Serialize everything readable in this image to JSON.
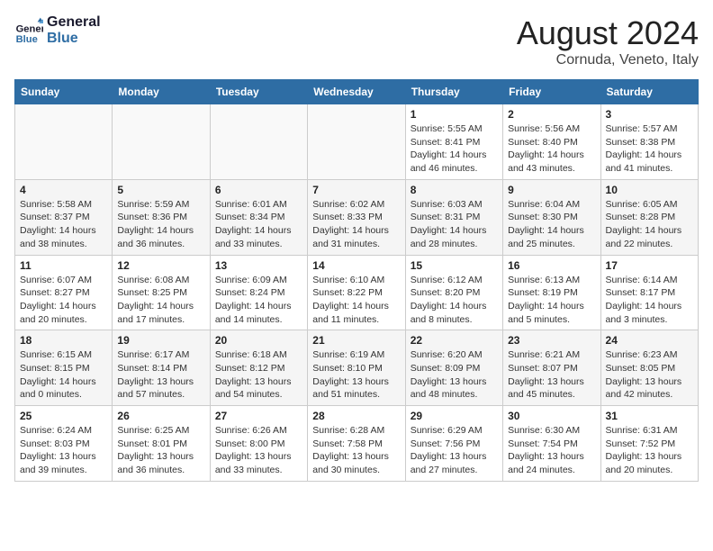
{
  "header": {
    "logo_line1": "General",
    "logo_line2": "Blue",
    "month_year": "August 2024",
    "location": "Cornuda, Veneto, Italy"
  },
  "weekdays": [
    "Sunday",
    "Monday",
    "Tuesday",
    "Wednesday",
    "Thursday",
    "Friday",
    "Saturday"
  ],
  "weeks": [
    [
      {
        "day": "",
        "info": ""
      },
      {
        "day": "",
        "info": ""
      },
      {
        "day": "",
        "info": ""
      },
      {
        "day": "",
        "info": ""
      },
      {
        "day": "1",
        "info": "Sunrise: 5:55 AM\nSunset: 8:41 PM\nDaylight: 14 hours\nand 46 minutes."
      },
      {
        "day": "2",
        "info": "Sunrise: 5:56 AM\nSunset: 8:40 PM\nDaylight: 14 hours\nand 43 minutes."
      },
      {
        "day": "3",
        "info": "Sunrise: 5:57 AM\nSunset: 8:38 PM\nDaylight: 14 hours\nand 41 minutes."
      }
    ],
    [
      {
        "day": "4",
        "info": "Sunrise: 5:58 AM\nSunset: 8:37 PM\nDaylight: 14 hours\nand 38 minutes."
      },
      {
        "day": "5",
        "info": "Sunrise: 5:59 AM\nSunset: 8:36 PM\nDaylight: 14 hours\nand 36 minutes."
      },
      {
        "day": "6",
        "info": "Sunrise: 6:01 AM\nSunset: 8:34 PM\nDaylight: 14 hours\nand 33 minutes."
      },
      {
        "day": "7",
        "info": "Sunrise: 6:02 AM\nSunset: 8:33 PM\nDaylight: 14 hours\nand 31 minutes."
      },
      {
        "day": "8",
        "info": "Sunrise: 6:03 AM\nSunset: 8:31 PM\nDaylight: 14 hours\nand 28 minutes."
      },
      {
        "day": "9",
        "info": "Sunrise: 6:04 AM\nSunset: 8:30 PM\nDaylight: 14 hours\nand 25 minutes."
      },
      {
        "day": "10",
        "info": "Sunrise: 6:05 AM\nSunset: 8:28 PM\nDaylight: 14 hours\nand 22 minutes."
      }
    ],
    [
      {
        "day": "11",
        "info": "Sunrise: 6:07 AM\nSunset: 8:27 PM\nDaylight: 14 hours\nand 20 minutes."
      },
      {
        "day": "12",
        "info": "Sunrise: 6:08 AM\nSunset: 8:25 PM\nDaylight: 14 hours\nand 17 minutes."
      },
      {
        "day": "13",
        "info": "Sunrise: 6:09 AM\nSunset: 8:24 PM\nDaylight: 14 hours\nand 14 minutes."
      },
      {
        "day": "14",
        "info": "Sunrise: 6:10 AM\nSunset: 8:22 PM\nDaylight: 14 hours\nand 11 minutes."
      },
      {
        "day": "15",
        "info": "Sunrise: 6:12 AM\nSunset: 8:20 PM\nDaylight: 14 hours\nand 8 minutes."
      },
      {
        "day": "16",
        "info": "Sunrise: 6:13 AM\nSunset: 8:19 PM\nDaylight: 14 hours\nand 5 minutes."
      },
      {
        "day": "17",
        "info": "Sunrise: 6:14 AM\nSunset: 8:17 PM\nDaylight: 14 hours\nand 3 minutes."
      }
    ],
    [
      {
        "day": "18",
        "info": "Sunrise: 6:15 AM\nSunset: 8:15 PM\nDaylight: 14 hours\nand 0 minutes."
      },
      {
        "day": "19",
        "info": "Sunrise: 6:17 AM\nSunset: 8:14 PM\nDaylight: 13 hours\nand 57 minutes."
      },
      {
        "day": "20",
        "info": "Sunrise: 6:18 AM\nSunset: 8:12 PM\nDaylight: 13 hours\nand 54 minutes."
      },
      {
        "day": "21",
        "info": "Sunrise: 6:19 AM\nSunset: 8:10 PM\nDaylight: 13 hours\nand 51 minutes."
      },
      {
        "day": "22",
        "info": "Sunrise: 6:20 AM\nSunset: 8:09 PM\nDaylight: 13 hours\nand 48 minutes."
      },
      {
        "day": "23",
        "info": "Sunrise: 6:21 AM\nSunset: 8:07 PM\nDaylight: 13 hours\nand 45 minutes."
      },
      {
        "day": "24",
        "info": "Sunrise: 6:23 AM\nSunset: 8:05 PM\nDaylight: 13 hours\nand 42 minutes."
      }
    ],
    [
      {
        "day": "25",
        "info": "Sunrise: 6:24 AM\nSunset: 8:03 PM\nDaylight: 13 hours\nand 39 minutes."
      },
      {
        "day": "26",
        "info": "Sunrise: 6:25 AM\nSunset: 8:01 PM\nDaylight: 13 hours\nand 36 minutes."
      },
      {
        "day": "27",
        "info": "Sunrise: 6:26 AM\nSunset: 8:00 PM\nDaylight: 13 hours\nand 33 minutes."
      },
      {
        "day": "28",
        "info": "Sunrise: 6:28 AM\nSunset: 7:58 PM\nDaylight: 13 hours\nand 30 minutes."
      },
      {
        "day": "29",
        "info": "Sunrise: 6:29 AM\nSunset: 7:56 PM\nDaylight: 13 hours\nand 27 minutes."
      },
      {
        "day": "30",
        "info": "Sunrise: 6:30 AM\nSunset: 7:54 PM\nDaylight: 13 hours\nand 24 minutes."
      },
      {
        "day": "31",
        "info": "Sunrise: 6:31 AM\nSunset: 7:52 PM\nDaylight: 13 hours\nand 20 minutes."
      }
    ]
  ]
}
